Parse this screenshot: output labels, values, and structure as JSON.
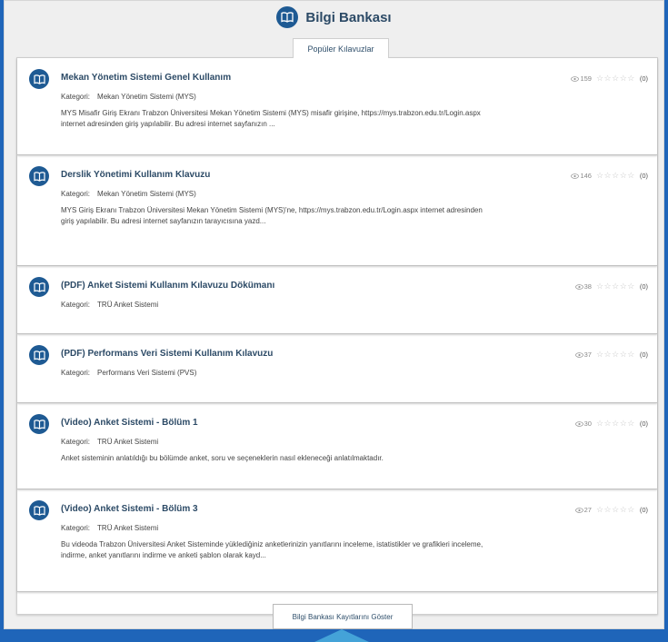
{
  "header": {
    "title": "Bilgi Bankası",
    "icon": "book-icon"
  },
  "tab": {
    "label": "Popüler Kılavuzlar"
  },
  "items": [
    {
      "title": "Mekan Yönetim Sistemi Genel Kullanım",
      "category_label": "Kategori:",
      "category": "Mekan Yönetim Sistemi (MYS)",
      "description": "MYS Misafir Giriş Ekranı Trabzon Üniversitesi Mekan Yönetim Sistemi (MYS) misafir girişine, https://mys.trabzon.edu.tr/Login.aspx internet adresinden giriş yapılabilir. Bu adresi internet sayfanızın ...",
      "views": "159",
      "stars": "☆☆☆☆☆",
      "rating_count": "(0)"
    },
    {
      "title": "Derslik Yönetimi Kullanım Klavuzu",
      "category_label": "Kategori:",
      "category": "Mekan Yönetim Sistemi (MYS)",
      "description": "MYS Giriş Ekranı Trabzon Üniversitesi Mekan Yönetim Sistemi (MYS)'ne, https://mys.trabzon.edu.tr/Login.aspx internet adresinden giriş yapılabilir. Bu adresi internet sayfanızın tarayıcısına yazd...",
      "views": "146",
      "stars": "☆☆☆☆☆",
      "rating_count": "(0)"
    },
    {
      "title": "(PDF) Anket Sistemi Kullanım Kılavuzu Dökümanı",
      "category_label": "Kategori:",
      "category": "TRÜ Anket Sistemi",
      "description": "",
      "views": "38",
      "stars": "☆☆☆☆☆",
      "rating_count": "(0)"
    },
    {
      "title": "(PDF) Performans Veri Sistemi Kullanım Kılavuzu",
      "category_label": "Kategori:",
      "category": "Performans Veri Sistemi (PVS)",
      "description": "",
      "views": "37",
      "stars": "☆☆☆☆☆",
      "rating_count": "(0)"
    },
    {
      "title": "(Video) Anket Sistemi - Bölüm 1",
      "category_label": "Kategori:",
      "category": "TRÜ Anket Sistemi",
      "description": "Anket sisteminin anlatıldığı bu bölümde anket, soru ve seçeneklerin nasıl ekleneceği anlatılmaktadır.",
      "views": "30",
      "stars": "☆☆☆☆☆",
      "rating_count": "(0)"
    },
    {
      "title": "(Video) Anket Sistemi - Bölüm 3",
      "category_label": "Kategori:",
      "category": "TRÜ Anket Sistemi",
      "description": "Bu videoda Trabzon Üniversitesi Anket Sisteminde yüklediğiniz anketlerinizin yanıtlarını inceleme, istatistikler ve grafikleri inceleme, indirme, anket yanıtlarını indirme ve anketi şablon olarak kayd...",
      "views": "27",
      "stars": "☆☆☆☆☆",
      "rating_count": "(0)"
    }
  ],
  "footer": {
    "button_label": "Bilgi Bankası Kayıtlarını Göster"
  },
  "colors": {
    "accent": "#1e5a93",
    "frame": "#1f65b9",
    "pointer": "#44a3d8"
  }
}
